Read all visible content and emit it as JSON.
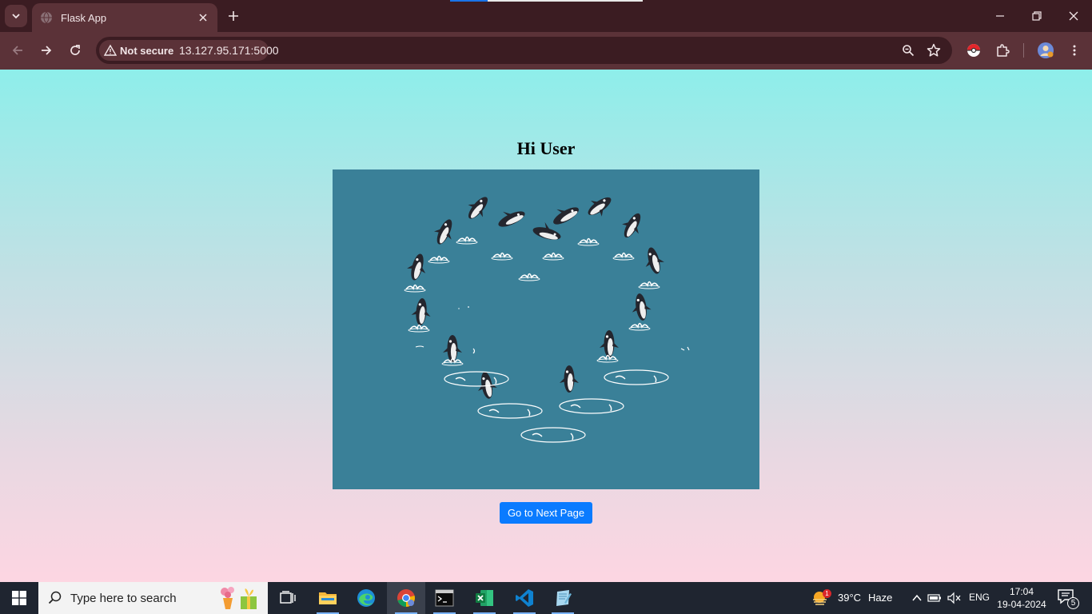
{
  "browser": {
    "tab_title": "Flask App",
    "url": "13.127.95.171:5000",
    "security_label": "Not secure"
  },
  "page": {
    "greeting": "Hi User",
    "next_button_label": "Go to Next Page",
    "hero_image_icon": "orca-heart-illustration"
  },
  "taskbar": {
    "search_placeholder": "Type here to search",
    "weather_temp": "39°C",
    "weather_condition": "Haze",
    "weather_badge": "1",
    "language": "ENG",
    "time": "17:04",
    "date": "19-04-2024",
    "notification_count": "5",
    "apps": [
      "task-view",
      "file-explorer",
      "edge",
      "chrome",
      "terminal",
      "excel",
      "vscode",
      "notepad"
    ]
  },
  "colors": {
    "accent_button": "#0a7bff",
    "hero_bg": "#3a8098",
    "chrome_frame": "#3b1c22",
    "chrome_toolbar": "#5b3238"
  }
}
